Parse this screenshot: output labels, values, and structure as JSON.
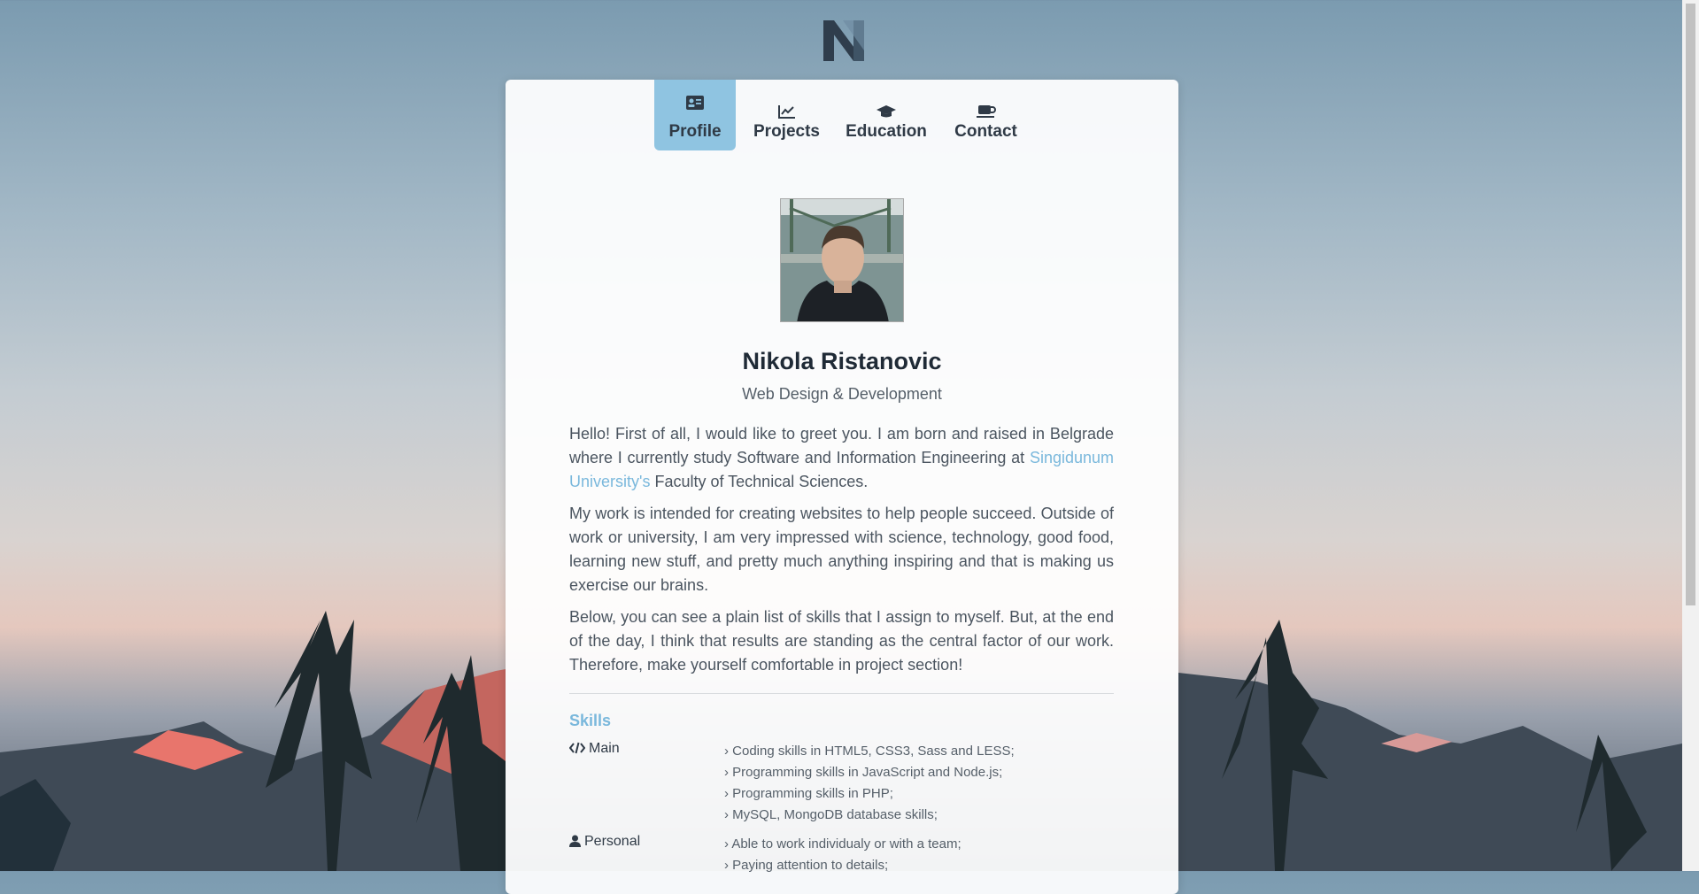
{
  "nav": {
    "tabs": [
      {
        "label": "Profile",
        "icon": "id-card-icon",
        "active": true
      },
      {
        "label": "Projects",
        "icon": "chart-line-icon",
        "active": false
      },
      {
        "label": "Education",
        "icon": "graduation-cap-icon",
        "active": false
      },
      {
        "label": "Contact",
        "icon": "coffee-icon",
        "active": false
      }
    ]
  },
  "profile": {
    "name": "Nikola Ristanovic",
    "subtitle": "Web Design & Development",
    "bio": {
      "p1_before": "Hello! First of all, I would like to greet you. I am born and raised in Belgrade where I currently study Software and Information Engineering at ",
      "p1_link": "Singidunum University's",
      "p1_after": " Faculty of Technical Sciences.",
      "p2": "My work is intended for creating websites to help people succeed. Outside of work or university, I am very impressed with science, technology, good food, learning new stuff, and pretty much anything inspiring and that is making us exercise our brains.",
      "p3": "Below, you can see a plain list of skills that I assign to myself. But, at the end of the day, I think that results are standing as the central factor of our work. Therefore, make yourself comfortable in project section!"
    }
  },
  "skills": {
    "title": "Skills",
    "main": {
      "label": "Main",
      "icon": "code-icon",
      "items": [
        "› Coding skills in HTML5, CSS3, Sass and LESS;",
        "› Programming skills in JavaScript and Node.js;",
        "› Programming skills in PHP;",
        "› MySQL, MongoDB database skills;"
      ]
    },
    "personal": {
      "label": "Personal",
      "icon": "user-icon",
      "items": [
        "› Able to work individualy or with a team;",
        "› Paying attention to details;"
      ]
    }
  },
  "colors": {
    "accent": "#8fc4e1",
    "link": "#7ab8dc",
    "text": "#4b5560"
  }
}
